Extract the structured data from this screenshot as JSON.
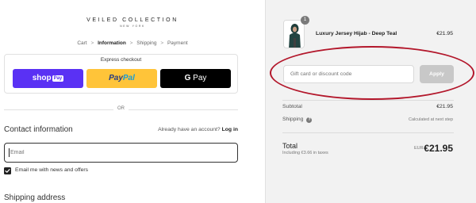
{
  "brand": {
    "name": "VEILED COLLECTION",
    "tagline": "NEW YORK"
  },
  "breadcrumbs": [
    {
      "label": "Cart"
    },
    {
      "label": "Information"
    },
    {
      "label": "Shipping"
    },
    {
      "label": "Payment"
    }
  ],
  "breadcrumb_separator": ">",
  "express": {
    "title": "Express checkout",
    "shop_pay": {
      "text": "shop",
      "badge": "Pay"
    },
    "paypal": {
      "pay": "Pay",
      "pal": "Pal"
    },
    "gpay": {
      "g": "G",
      "text": "Pay"
    }
  },
  "divider_text": "OR",
  "contact": {
    "title": "Contact information",
    "account_prompt": "Already have an account?",
    "login_label": "Log in",
    "email_placeholder": "Email",
    "newsletter_label": "Email me with news and offers",
    "newsletter_checked": true
  },
  "shipping": {
    "title": "Shipping address"
  },
  "cart": {
    "quantity": "1",
    "product_name": "Luxury Jersey Hijab - Deep Teal",
    "product_price": "€21.95"
  },
  "discount": {
    "placeholder": "Gift card or discount code",
    "apply_label": "Apply"
  },
  "summary": {
    "subtotal_label": "Subtotal",
    "subtotal_value": "€21.95",
    "shipping_label": "Shipping",
    "shipping_info_icon": "?",
    "shipping_value": "Calculated at next step",
    "total_label": "Total",
    "tax_note": "Including €3.66 in taxes",
    "currency": "EUR",
    "total_value": "€21.95"
  },
  "colors": {
    "shop_pay": "#5a31f4",
    "paypal": "#ffc439",
    "gpay": "#000000",
    "annotation": "#b3172b",
    "summary_bg": "#f2f2f2"
  }
}
